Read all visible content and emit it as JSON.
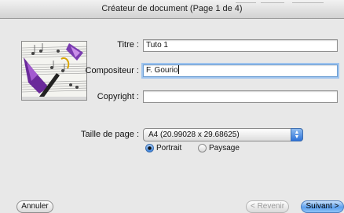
{
  "window": {
    "title": "Créateur de document (Page 1 de 4)"
  },
  "form": {
    "title_label": "Titre :",
    "title_value": "Tuto 1",
    "composer_label": "Compositeur :",
    "composer_value": "F. Gourio",
    "copyright_label": "Copyright :",
    "copyright_value": "",
    "page_size_label": "Taille de page :",
    "page_size_value": "A4 (20.99028 x 29.68625)"
  },
  "orientation": {
    "selected": "Portrait",
    "options": [
      "Portrait",
      "Paysage"
    ]
  },
  "buttons": {
    "cancel": "Annuler",
    "back": "< Revenir",
    "next": "Suivant >"
  },
  "colors": {
    "accent": "#2c72d8",
    "focus_ring": "#9fc4ee"
  }
}
